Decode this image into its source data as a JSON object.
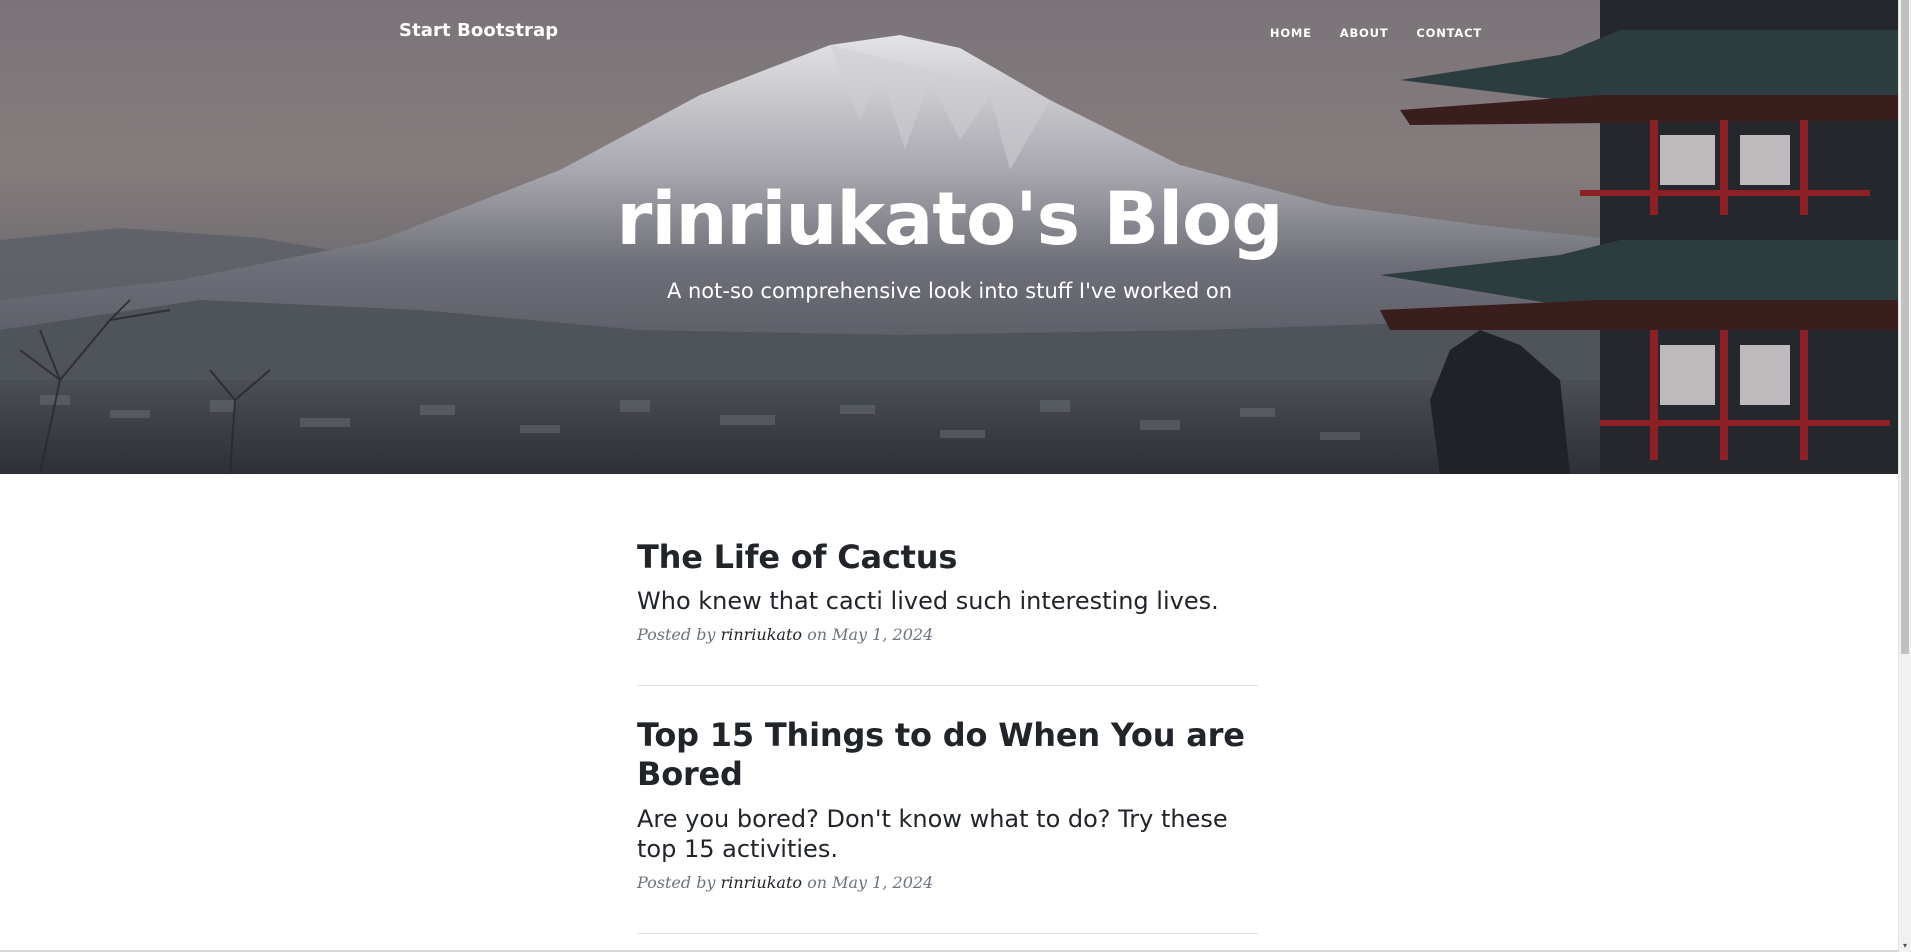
{
  "navbar": {
    "brand": "Start Bootstrap",
    "links": [
      "HOME",
      "ABOUT",
      "CONTACT"
    ]
  },
  "header": {
    "title": "rinriukato's Blog",
    "subtitle": "A not-so comprehensive look into stuff I've worked on"
  },
  "posts": [
    {
      "title": "The Life of Cactus",
      "subtitle": "Who knew that cacti lived such interesting lives.",
      "meta_prefix": "Posted by",
      "author": "rinriukato",
      "meta_suffix": "on May 1, 2024"
    },
    {
      "title": "Top 15 Things to do When You are Bored",
      "subtitle": "Are you bored? Don't know what to do? Try these top 15 activities.",
      "meta_prefix": "Posted by",
      "author": "rinriukato",
      "meta_suffix": "on May 1, 2024"
    }
  ],
  "icons": {
    "scroll_down": "chevron-down-icon"
  },
  "colors": {
    "text": "#212529",
    "meta": "#6c757d",
    "divider": "#dee2e6"
  }
}
